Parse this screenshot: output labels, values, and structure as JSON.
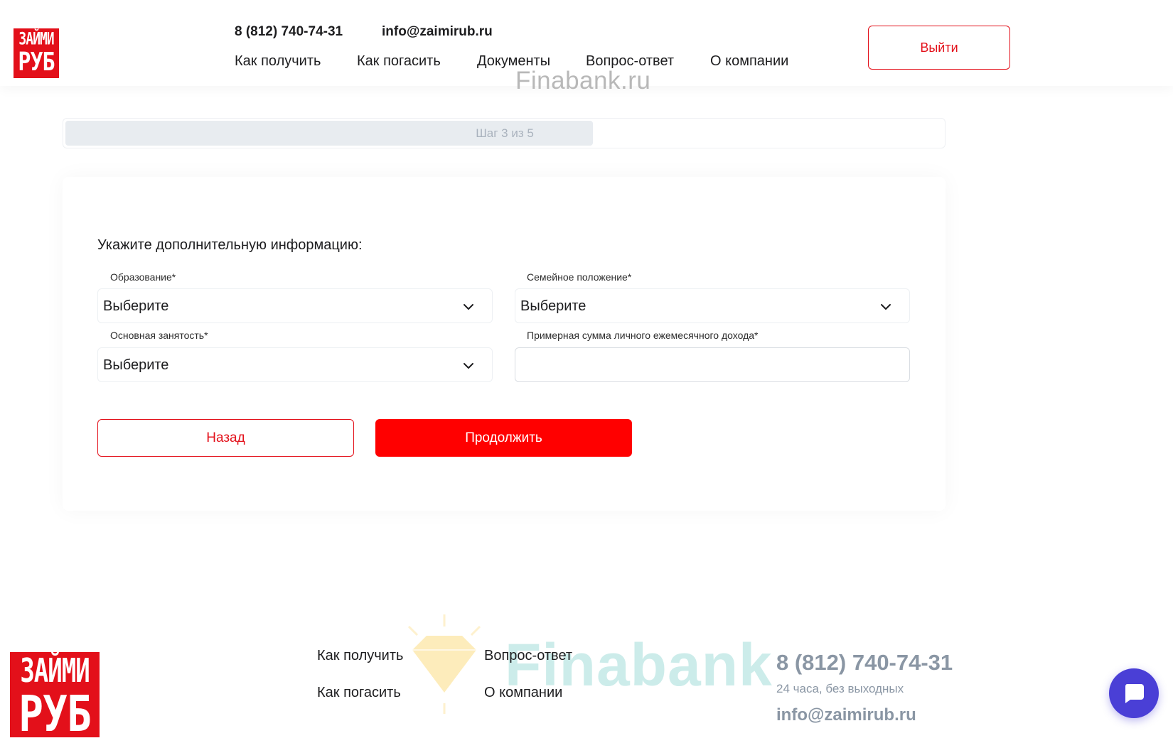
{
  "header": {
    "logo_line1": "ЗАЙМИ",
    "logo_line2": "РУБ",
    "phone": "8 (812) 740-74-31",
    "email": "info@zaimirub.ru",
    "nav": [
      "Как получить",
      "Как погасить",
      "Документы",
      "Вопрос-ответ",
      "О компании"
    ],
    "logout_label": "Выйти",
    "watermark": "Finabank.ru"
  },
  "progress": {
    "label": "Шаг 3 из 5",
    "fraction": 0.6
  },
  "form": {
    "title": "Укажите дополнительную информацию:",
    "education": {
      "label": "Образование*",
      "value": "Выберите"
    },
    "marital": {
      "label": "Семейное положение*",
      "value": "Выберите"
    },
    "employment": {
      "label": "Основная занятость*",
      "value": "Выберите"
    },
    "income": {
      "label": "Примерная сумма личного ежемесячного дохода*",
      "value": ""
    },
    "back_label": "Назад",
    "next_label": "Продолжить"
  },
  "footer": {
    "logo_line1": "ЗАЙМИ",
    "logo_line2": "РУБ",
    "links": [
      "Как получить",
      "Как погасить",
      "Вопрос-ответ",
      "О компании"
    ],
    "phone": "8 (812) 740-74-31",
    "hours": "24 часа, без выходных",
    "email": "info@zaimirub.ru",
    "watermark": "Finabank"
  },
  "colors": {
    "brand_red": "#e3101a",
    "primary_button": "#ff0000",
    "chat_button": "#4a3fd6"
  },
  "icons": {
    "dropdown": "chevron-down-icon",
    "chat": "chat-bubble-icon",
    "watermark_logo": "diamond-icon"
  }
}
